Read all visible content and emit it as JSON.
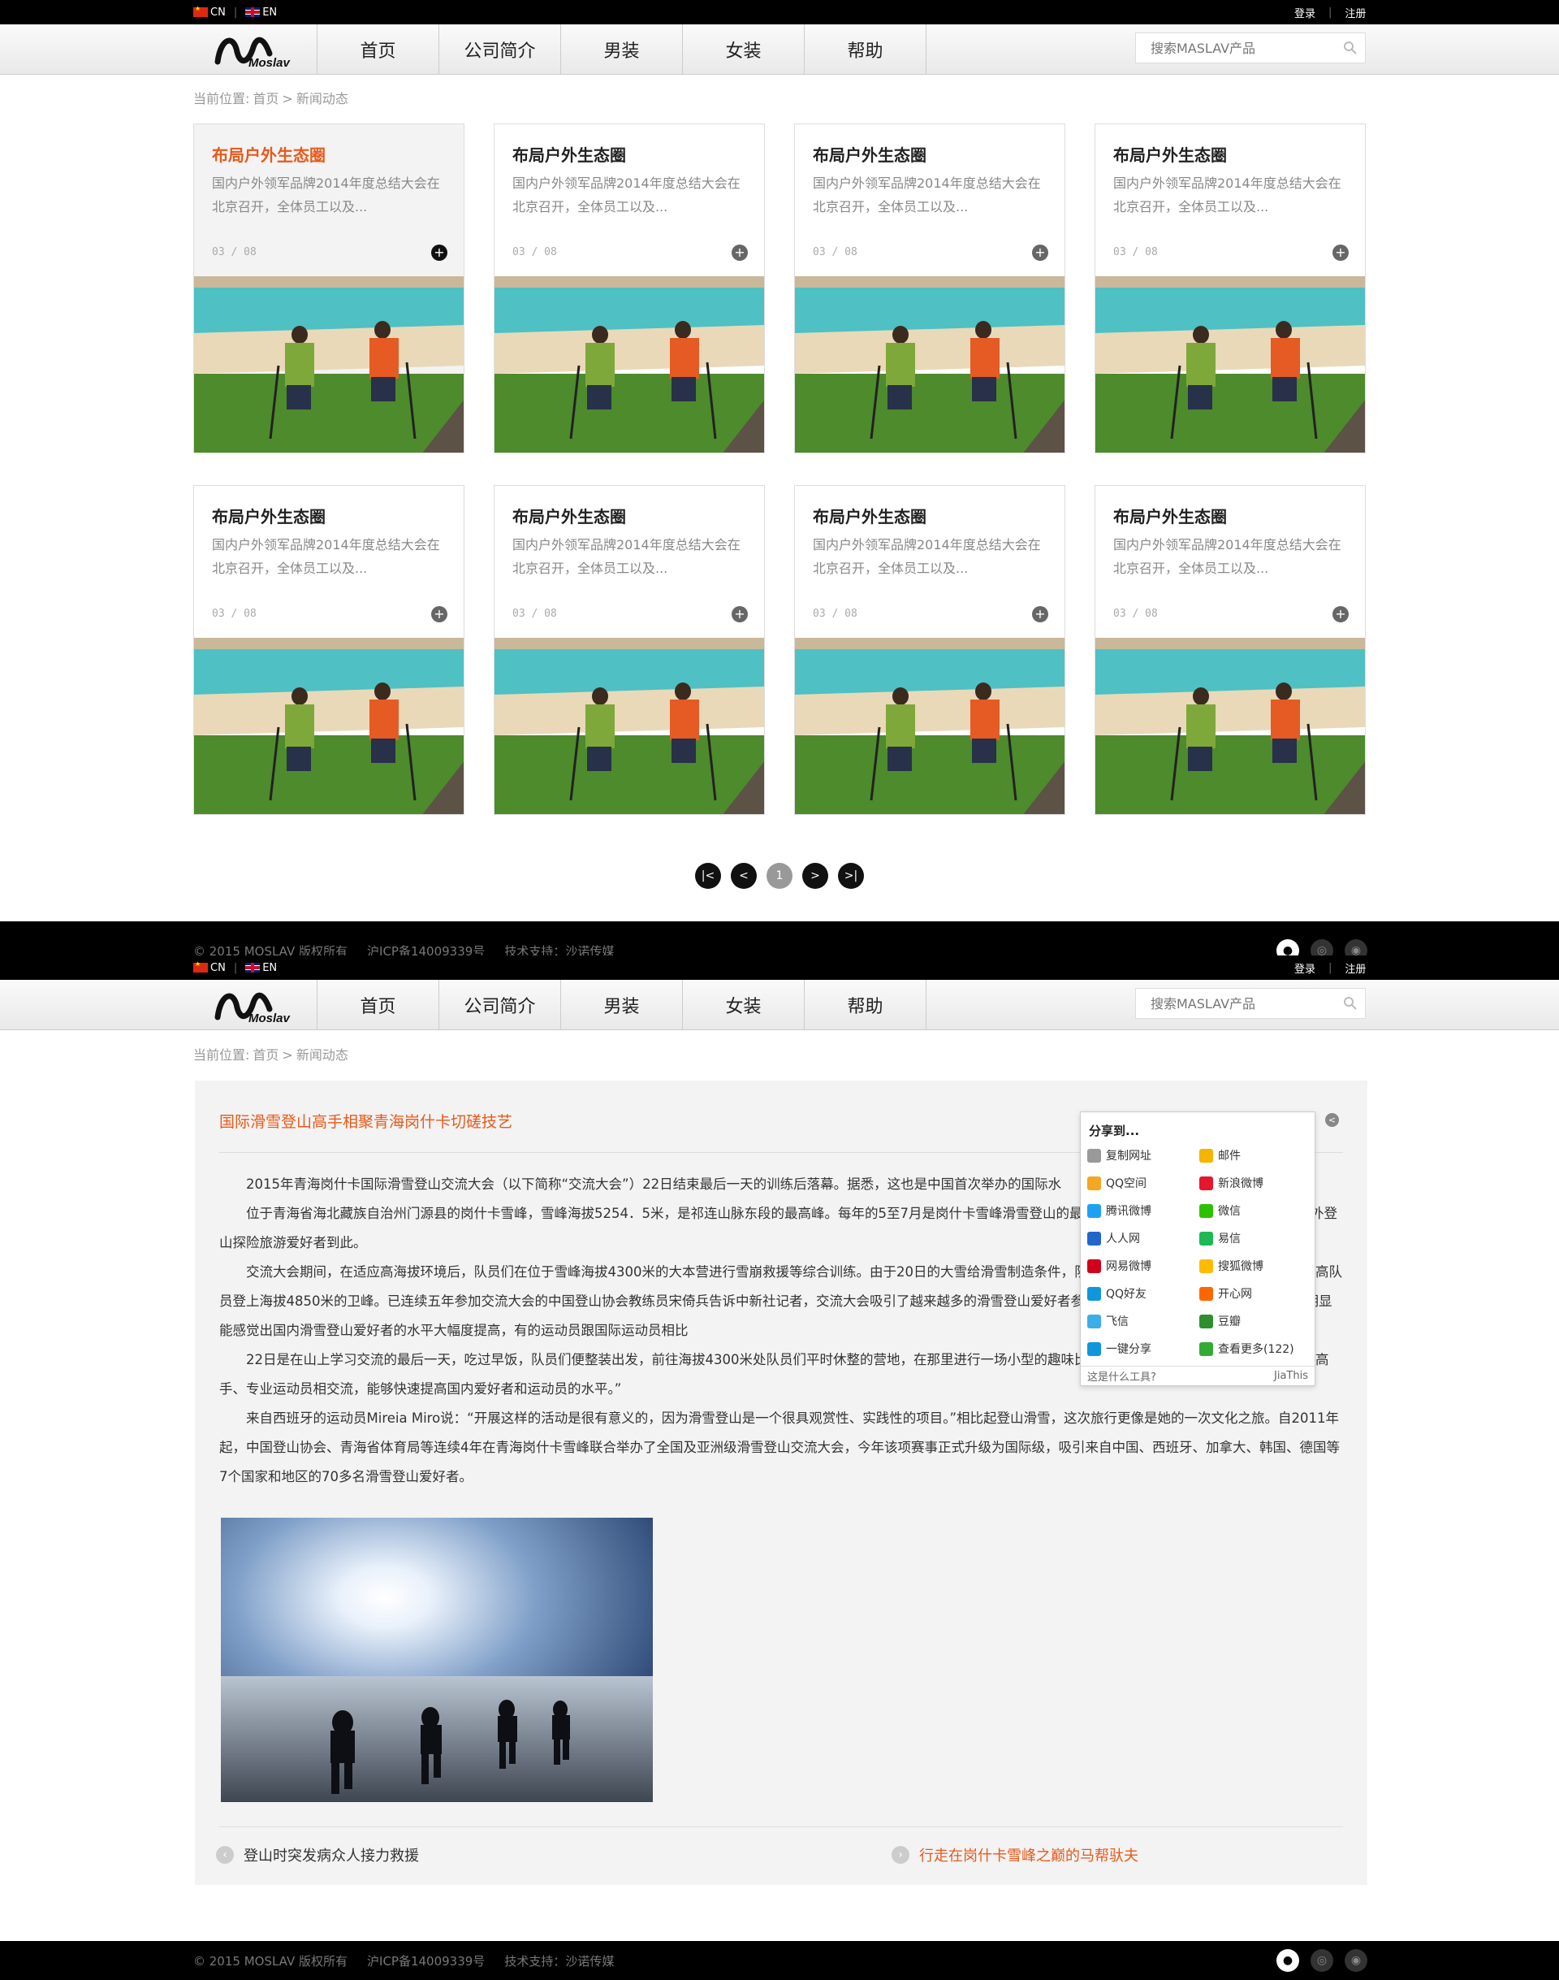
{
  "header": {
    "lang_cn": "CN",
    "lang_en": "EN",
    "login": "登录",
    "register": "注册",
    "logo_text": "Moslav",
    "nav": [
      "首页",
      "公司简介",
      "男装",
      "女装",
      "帮助"
    ],
    "search_placeholder": "搜索MASLAV产品"
  },
  "breadcrumb": {
    "prefix": "当前位置:",
    "home": "首页",
    "current": "新闻动态"
  },
  "news_cards": [
    {
      "title": "布局户外生态圈",
      "desc": "国内户外领军品牌2014年度总结大会在北京召开，全体员工以及...",
      "date": "03 / 08"
    },
    {
      "title": "布局户外生态圈",
      "desc": "国内户外领军品牌2014年度总结大会在北京召开，全体员工以及...",
      "date": "03 / 08"
    },
    {
      "title": "布局户外生态圈",
      "desc": "国内户外领军品牌2014年度总结大会在北京召开，全体员工以及...",
      "date": "03 / 08"
    },
    {
      "title": "布局户外生态圈",
      "desc": "国内户外领军品牌2014年度总结大会在北京召开，全体员工以及...",
      "date": "03 / 08"
    },
    {
      "title": "布局户外生态圈",
      "desc": "国内户外领军品牌2014年度总结大会在北京召开，全体员工以及...",
      "date": "03 / 08"
    },
    {
      "title": "布局户外生态圈",
      "desc": "国内户外领军品牌2014年度总结大会在北京召开，全体员工以及...",
      "date": "03 / 08"
    },
    {
      "title": "布局户外生态圈",
      "desc": "国内户外领军品牌2014年度总结大会在北京召开，全体员工以及...",
      "date": "03 / 08"
    },
    {
      "title": "布局户外生态圈",
      "desc": "国内户外领军品牌2014年度总结大会在北京召开，全体员工以及...",
      "date": "03 / 08"
    }
  ],
  "pagination": {
    "first": "|<",
    "prev": "<",
    "current": "1",
    "next": ">",
    "last": ">|"
  },
  "footer": {
    "copyright": "© 2015 MOSLAV 版权所有",
    "icp": "沪ICP备14009339号",
    "support": "技术支持：沙诺传媒"
  },
  "article": {
    "title": "国际滑雪登山高手相聚青海岗什卡切磋技艺",
    "paragraphs": [
      "2015年青海岗什卡国际滑雪登山交流大会（以下简称“交流大会”）22日结束最后一天的训练后落幕。据悉，这也是中国首次举办的国际水",
      "位于青海省海北藏族自治州门源县的岗什卡雪峰，雪峰海拔5254．5米，是祁连山脉东段的最高峰。每年的5至7月是岗什卡雪峰滑雪登山的最佳季节，视野开阔，吸引了众多的国内外登山探险旅游爱好者到此。",
      "交流大会期间，在适应高海拔环境后，队员们在位于雪峰海拔4300米的大本营进行雪崩救援等综合训练。由于20日的大雪给滑雪制造条件，队员们在雪点进行滑雪训练，部分水平较高队员登上海拔4850米的卫峰。已连续五年参加交流大会的中国登山协会教练员宋倚兵告诉中新社记者，交流大会吸引了越来越多的滑雪登山爱好者参加到此次赛事。“跟前几次相比，这次明显能感觉出国内滑雪登山爱好者的水平大幅度提高，有的运动员跟国际运动员相比",
      "22日是在山上学习交流的最后一天，吃过早饭，队员们便整装出发，前往海拔4300米处队员们平时休整的营地，在那里进行一场小型的趣味比赛。参加交流大会，可以跟更多的国际高手、专业运动员相交流，能够快速提高国内爱好者和运动员的水平。”",
      "来自西班牙的运动员Mireia Miro说：“开展这样的活动是很有意义的，因为滑雪登山是一个很具观赏性、实践性的项目。”相比起登山滑雪，这次旅行更像是她的一次文化之旅。自2011年起，中国登山协会、青海省体育局等连续4年在青海岗什卡雪峰联合举办了全国及亚洲级滑雪登山交流大会，今年该项赛事正式升级为国际级，吸引来自中国、西班牙、加拿大、韩国、德国等7个国家和地区的70多名滑雪登山爱好者。"
    ],
    "prev_title": "登山时突发病众人接力救援",
    "next_title": "行走在岗什卡雪峰之巅的马帮驮夫"
  },
  "share": {
    "title": "分享到...",
    "items": [
      "复制网址",
      "邮件",
      "QQ空间",
      "新浪微博",
      "腾讯微博",
      "微信",
      "人人网",
      "易信",
      "网易微博",
      "搜狐微博",
      "QQ好友",
      "开心网",
      "飞信",
      "豆瓣",
      "一键分享",
      "查看更多(122)"
    ],
    "footer_left": "这是什么工具?",
    "footer_right": "JiaThis"
  },
  "colors": {
    "accent": "#e8591a",
    "topbar": "#000000",
    "card_border": "#dddddd"
  }
}
